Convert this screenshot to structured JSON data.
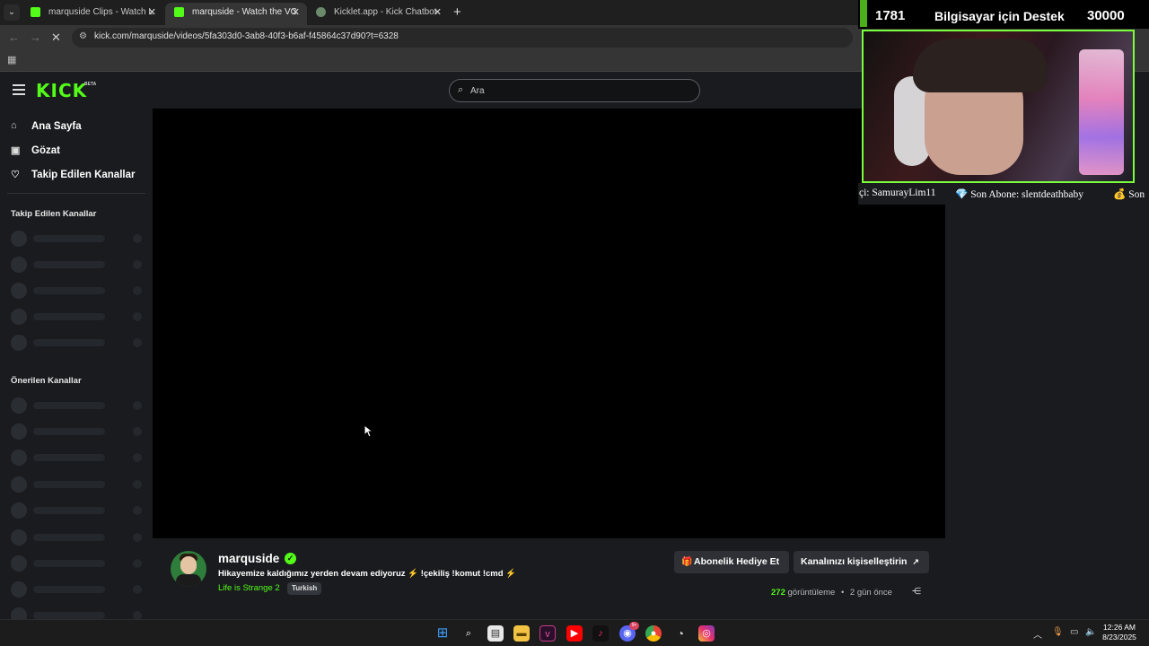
{
  "browser": {
    "tabs": [
      {
        "title": "marquside Clips - Watch Live o",
        "active": false
      },
      {
        "title": "marquside - Watch the VOD o",
        "active": true
      },
      {
        "title": "Kicklet.app - Kick Chatbot and",
        "active": false
      }
    ],
    "url": "kick.com/marquside/videos/5fa303d0-3ab8-40f3-b6af-f45864c37d90?t=6328"
  },
  "header": {
    "logo": "KICK",
    "logo_badge": "BETA",
    "search_placeholder": "Ara"
  },
  "sidebar": {
    "nav": [
      {
        "label": "Ana Sayfa",
        "icon": "home-icon"
      },
      {
        "label": "Gözat",
        "icon": "browse-icon"
      },
      {
        "label": "Takip Edilen Kanallar",
        "icon": "heart-icon"
      }
    ],
    "followed_heading": "Takip Edilen Kanallar",
    "recommended_heading": "Önerilen Kanallar"
  },
  "overlay": {
    "top_left": "1781",
    "top_center": "Bilgisayar için Destek",
    "top_right": "30000",
    "ticker_1": "çi: SamurayLim11",
    "ticker_2": "💎 Son Abone: slentdeathbaby",
    "ticker_3": "💰 Son"
  },
  "channel": {
    "name": "marquside",
    "title": "Hikayemize kaldığımız yerden devam ediyoruz",
    "title_bolt": "⚡",
    "title_commands": "!çekiliş !komut !cmd",
    "category": "Life is Strange 2",
    "tag": "Turkish",
    "gift_button": "Abonelik Hediye Et",
    "customize_button": "Kanalınızı kişiselleştirin",
    "views_count": "272",
    "views_label": "görüntüleme",
    "time_ago": "2 gün önce"
  },
  "taskbar": {
    "time": "12:26 AM",
    "date": "8/23/2025",
    "badge": "9+"
  },
  "colors": {
    "kick_green": "#53fc18",
    "bg": "#191b1f",
    "overlay_border": "#79ff3c"
  }
}
